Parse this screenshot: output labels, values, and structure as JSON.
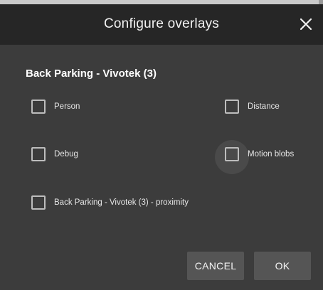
{
  "dialog": {
    "title": "Configure overlays",
    "close_icon": "close-icon"
  },
  "camera": {
    "name": "Back Parking - Vivotek (3)"
  },
  "overlays": [
    {
      "label": "Person",
      "checked": false
    },
    {
      "label": "Distance",
      "checked": false
    },
    {
      "label": "Debug",
      "checked": false
    },
    {
      "label": "Motion blobs",
      "checked": false,
      "hovered": true
    },
    {
      "label": "Back Parking - Vivotek (3) - proximity",
      "checked": false
    }
  ],
  "buttons": {
    "cancel": "CANCEL",
    "ok": "OK"
  },
  "colors": {
    "dialog_bg": "#3c3c3c",
    "title_bar_bg": "#262626",
    "button_bg": "#555555",
    "text": "#e6e6e6"
  }
}
